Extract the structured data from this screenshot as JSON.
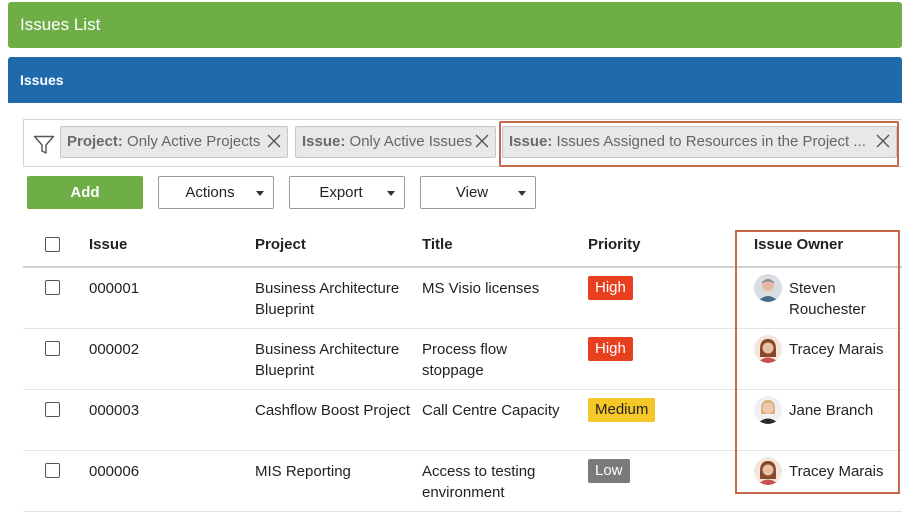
{
  "header": {
    "title": "Issues List"
  },
  "panel": {
    "title": "Issues"
  },
  "filters": [
    {
      "key": "Project:",
      "value": "Only Active Projects"
    },
    {
      "key": "Issue:",
      "value": "Only Active Issues"
    },
    {
      "key": "Issue:",
      "value": "Issues Assigned to Resources in the Project ..."
    }
  ],
  "toolbar": {
    "add": "Add",
    "actions": "Actions",
    "export": "Export",
    "view": "View"
  },
  "columns": {
    "issue": "Issue",
    "project": "Project",
    "title": "Title",
    "priority": "Priority",
    "owner": "Issue Owner"
  },
  "rows": [
    {
      "issue": "000001",
      "project": "Business Architecture Blueprint",
      "title": "MS Visio licenses",
      "priority": "High",
      "owner": "Steven Rouchester"
    },
    {
      "issue": "000002",
      "project": "Business Architecture Blueprint",
      "title": "Process flow stoppage",
      "priority": "High",
      "owner": "Tracey Marais"
    },
    {
      "issue": "000003",
      "project": "Cashflow Boost Project",
      "title": "Call Centre Capacity",
      "priority": "Medium",
      "owner": "Jane Branch"
    },
    {
      "issue": "000006",
      "project": "MIS Reporting",
      "title": "Access to testing environment",
      "priority": "Low",
      "owner": "Tracey Marais"
    }
  ],
  "colors": {
    "header_green": "#6fad47",
    "panel_blue": "#1e6aab",
    "priority_high": "#e8401f",
    "priority_medium": "#f5c827",
    "priority_low": "#7a7a7a",
    "highlight": "#c46a4a"
  },
  "icons": {
    "filter": "funnel-icon",
    "remove": "close-icon",
    "dropdown": "caret-down-icon"
  }
}
